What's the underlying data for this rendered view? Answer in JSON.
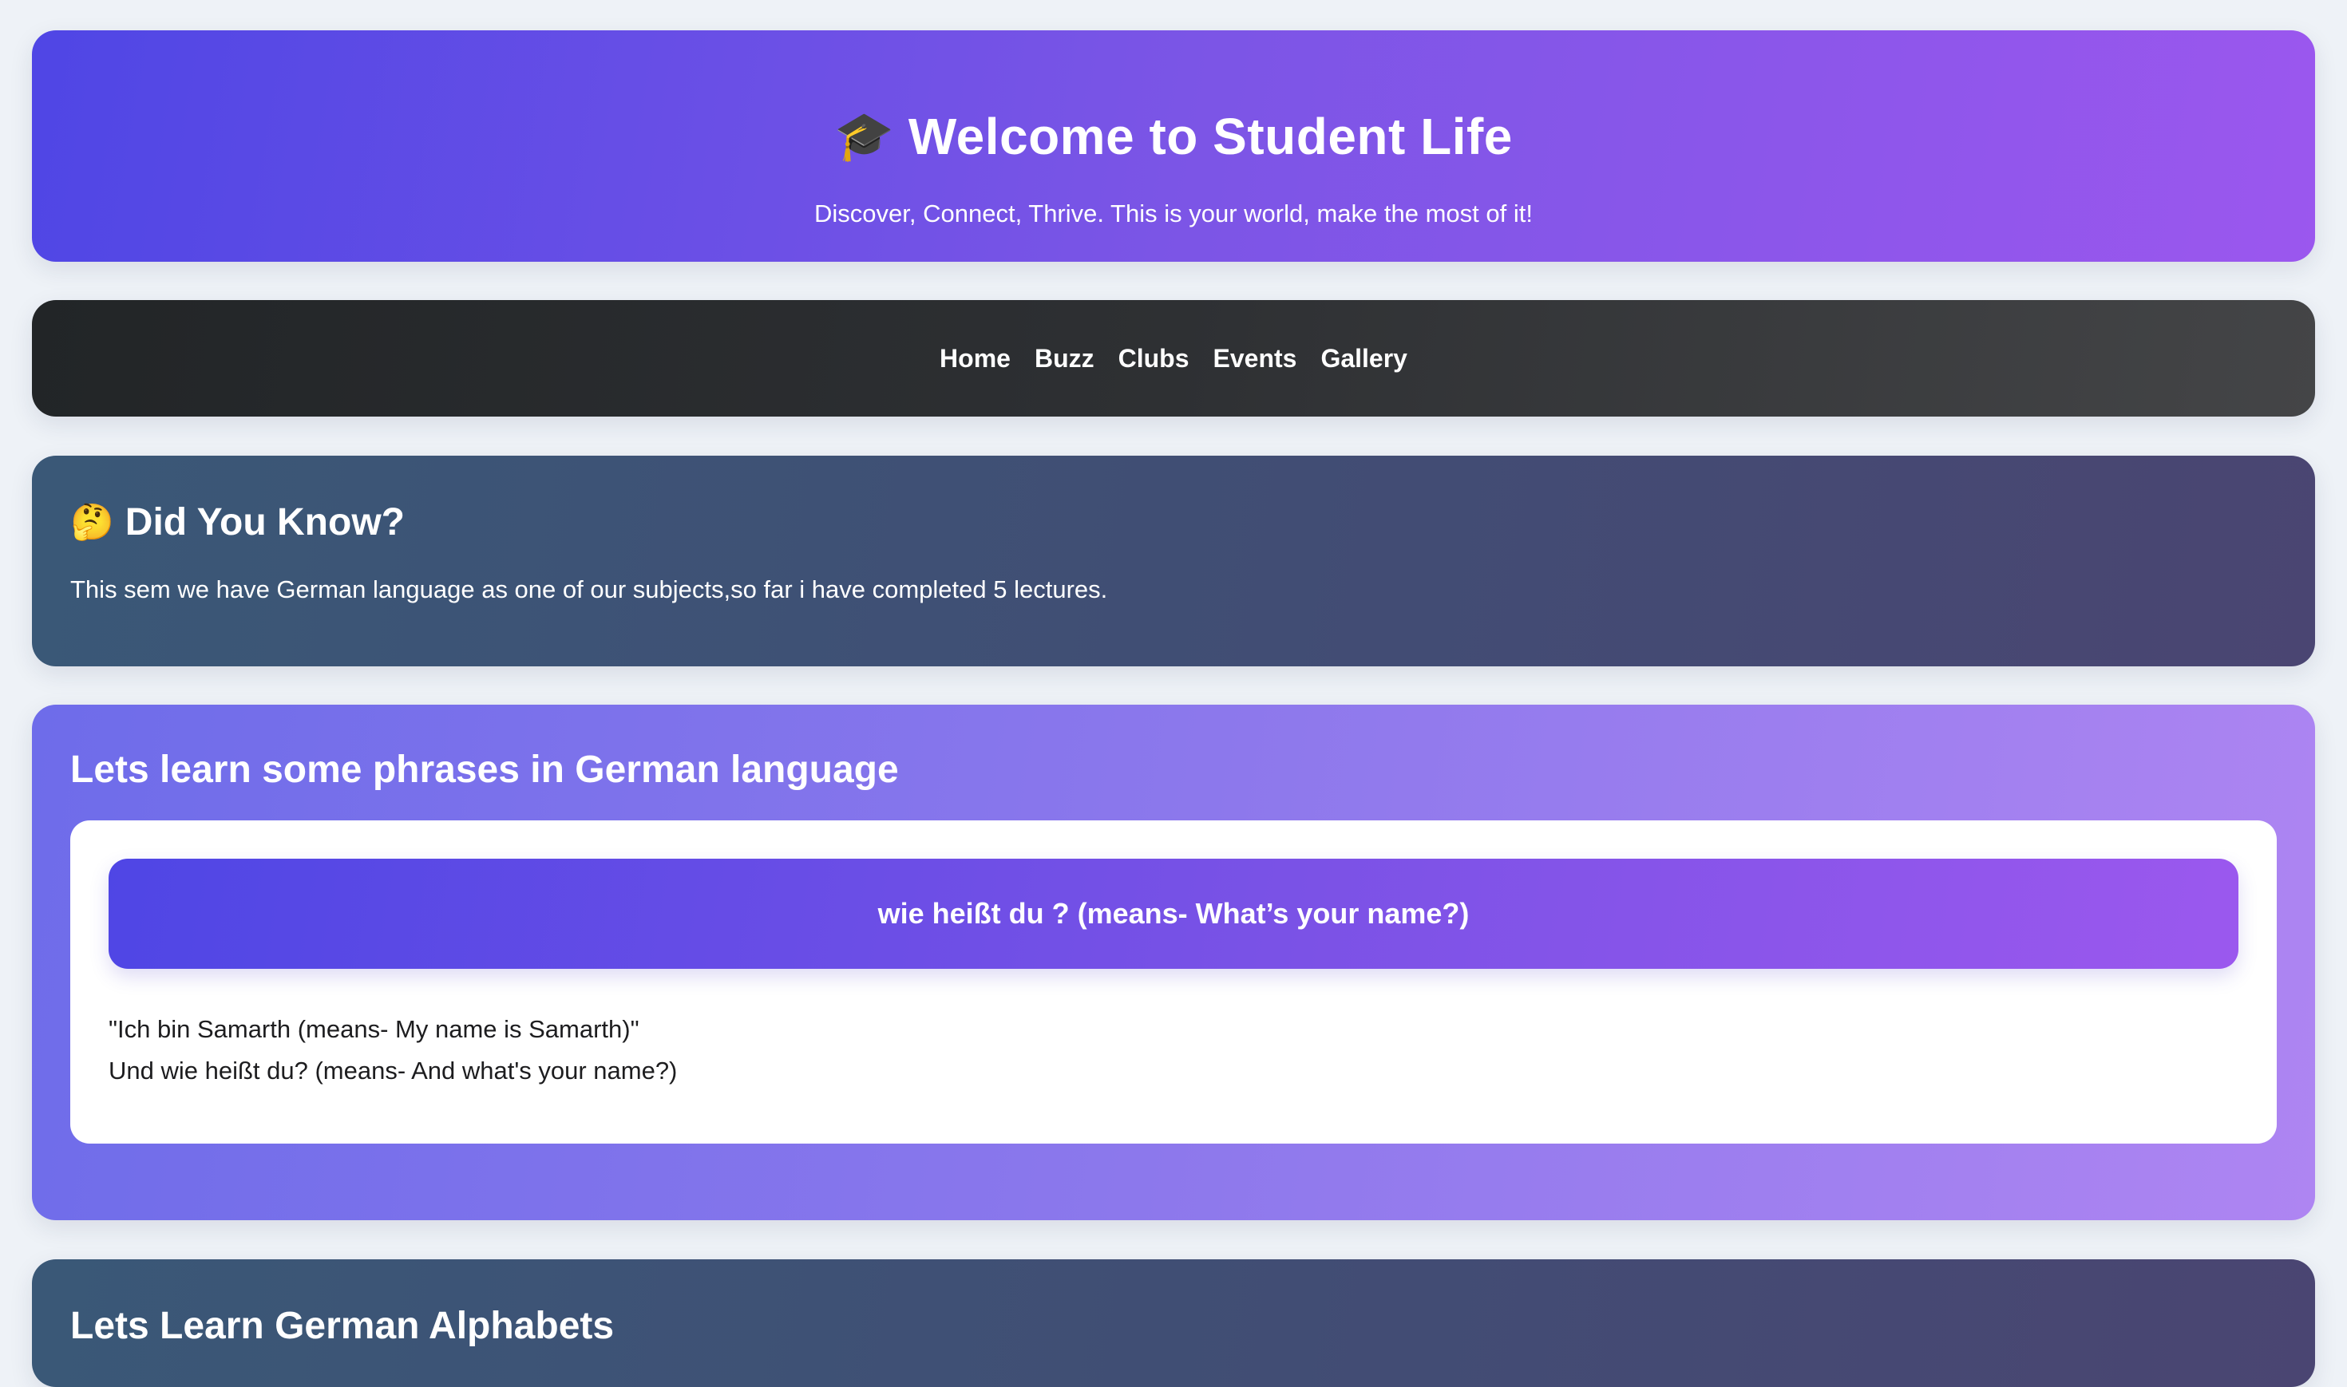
{
  "header": {
    "icon": "graduation-cap-icon",
    "icon_glyph": "🎓",
    "title": "Welcome to Student Life",
    "subtitle": "Discover, Connect, Thrive. This is your world, make the most of it!"
  },
  "nav": {
    "items": [
      {
        "label": "Home"
      },
      {
        "label": "Buzz"
      },
      {
        "label": "Clubs"
      },
      {
        "label": "Events"
      },
      {
        "label": "Gallery"
      }
    ]
  },
  "did_you_know": {
    "icon": "thinking-face-icon",
    "icon_glyph": "🤔",
    "heading": "Did You Know?",
    "text": "This sem we have German language as one of our subjects,so far i have completed 5 lectures."
  },
  "phrases": {
    "heading": "Lets learn some phrases in German language",
    "question": "wie heißt du ? (means- What’s your name?)",
    "lines": [
      "\"Ich bin Samarth (means- My name is Samarth)\"",
      "Und wie heißt du? (means- And what's your name?)"
    ]
  },
  "alphabets": {
    "heading": "Lets Learn German Alphabets"
  },
  "colors": {
    "page_bg": "#eef2f7",
    "header_gradient_start": "#4f46e5",
    "header_gradient_end": "#9b57ee",
    "nav_bg": "#2e3033",
    "info_card_bg": "#414d74",
    "phrases_gradient_start": "#6e6cea",
    "phrases_gradient_end": "#ae85f2"
  }
}
